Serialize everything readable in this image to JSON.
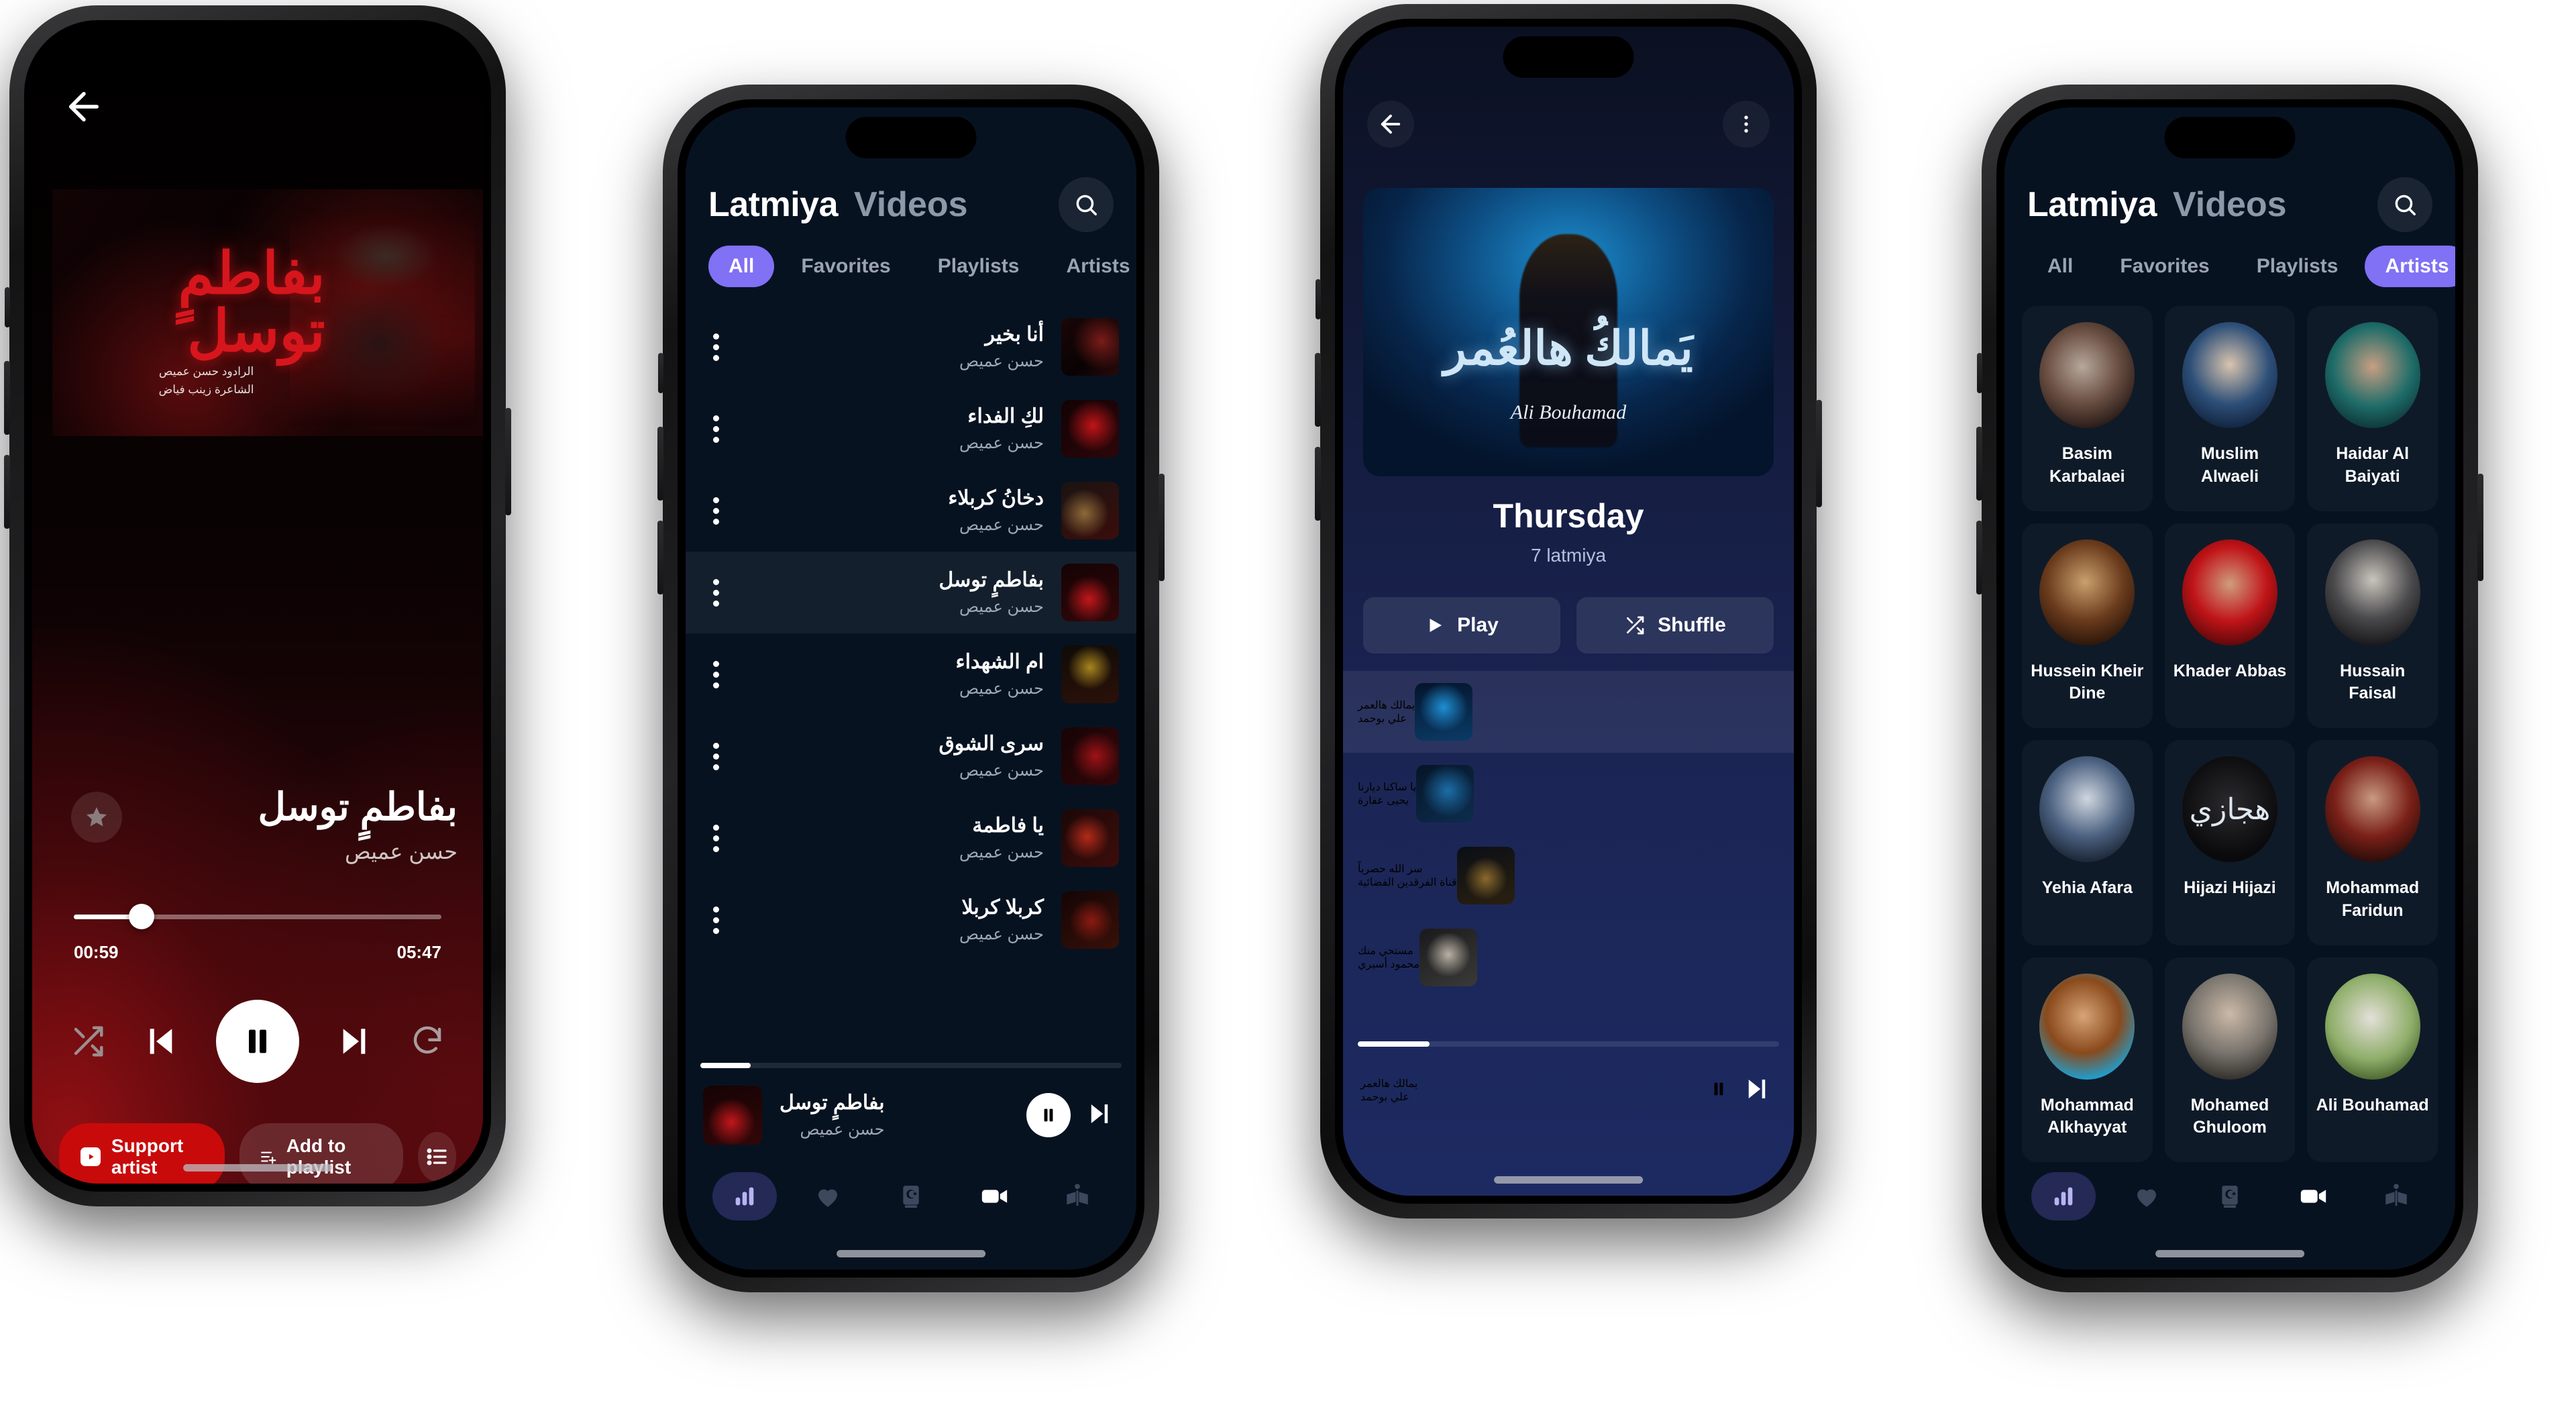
{
  "background_color": "#ffffff",
  "accent_purple": "#8071f5",
  "phone1_now_playing": {
    "back_icon": "arrow-left-icon",
    "favorite_icon": "star-icon",
    "artwork_calligraphy": "بفاطمٍ توسل",
    "artwork_credit_line1": "الرادود حسن عميص",
    "artwork_credit_line2": "الشاعرة زينب فياض",
    "track_title": "بفاطمٍ توسل",
    "track_artist": "حسن عميص",
    "time_elapsed": "00:59",
    "time_total": "05:47",
    "progress_percent": 17,
    "controls": {
      "shuffle": "shuffle-icon",
      "previous": "skip-previous-icon",
      "play_pause": "pause-icon",
      "next": "skip-next-icon",
      "repeat": "repeat-icon"
    },
    "support_button": "Support artist",
    "add_playlist_button": "Add to playlist",
    "queue_icon": "queue-list-icon"
  },
  "phone2_videos": {
    "brand": "Latmiya",
    "brand_secondary": "Videos",
    "search_icon": "search-icon",
    "tabs": [
      {
        "label": "All",
        "active": true
      },
      {
        "label": "Favorites",
        "active": false
      },
      {
        "label": "Playlists",
        "active": false
      },
      {
        "label": "Artists",
        "active": false
      }
    ],
    "rows": [
      {
        "title": "أنا بخير",
        "artist": "حسن عميص",
        "selected": false,
        "art": "tm-a"
      },
      {
        "title": "لكِ الفداء",
        "artist": "حسن عميص",
        "selected": false,
        "art": "tm-b"
      },
      {
        "title": "دخانُ كربلاء",
        "artist": "حسن عميص",
        "selected": false,
        "art": "tm-c"
      },
      {
        "title": "بفاطمٍ توسل",
        "artist": "حسن عميص",
        "selected": true,
        "art": "tm-d"
      },
      {
        "title": "ام الشهداء",
        "artist": "حسن عميص",
        "selected": false,
        "art": "tm-e"
      },
      {
        "title": "سرى الشوق",
        "artist": "حسن عميص",
        "selected": false,
        "art": "tm-f"
      },
      {
        "title": "يا فاطمة",
        "artist": "حسن عميص",
        "selected": false,
        "art": "tm-g"
      },
      {
        "title": "كربلا كربلا",
        "artist": "حسن عميص",
        "selected": false,
        "art": "tm-h"
      }
    ],
    "mini_player": {
      "title": "بفاطمٍ توسل",
      "artist": "حسن عميص",
      "play_pause_icon": "pause-icon",
      "next_icon": "skip-next-icon"
    },
    "nav": [
      {
        "name": "equalizer-icon",
        "active": true
      },
      {
        "name": "heart-icon",
        "active": false
      },
      {
        "name": "quran-book-icon",
        "active": false
      },
      {
        "name": "video-camera-icon",
        "active": true
      },
      {
        "name": "open-book-icon",
        "active": false
      }
    ]
  },
  "phone3_album": {
    "back_icon": "arrow-left-icon",
    "more_icon": "more-vertical-icon",
    "cover_calligraphy": "يَمالكُ هالعُمر",
    "cover_signature": "Ali Bouhamad",
    "album_title": "Thursday",
    "album_subtitle": "7 latmiya",
    "play_button": "Play",
    "shuffle_button": "Shuffle",
    "rows": [
      {
        "title": "يمالك هالعمر",
        "artist": "علي بوحمد",
        "selected": true,
        "art": "tm-i"
      },
      {
        "title": "يا ساكنا ديارنا",
        "artist": "يحيى عفارة",
        "selected": false,
        "art": "tm-j"
      },
      {
        "title": "سر الله حصرياً",
        "artist": "قناة الفرقدين الفضائية",
        "selected": false,
        "art": "tm-k"
      },
      {
        "title": "مستحي منك",
        "artist": "محمود أسيري",
        "selected": false,
        "art": "tm-l"
      }
    ],
    "mini_player": {
      "title": "يمالك هالعمر",
      "artist": "علي بوحمد",
      "play_pause_icon": "pause-icon",
      "next_icon": "skip-next-icon"
    }
  },
  "phone4_artists": {
    "brand": "Latmiya",
    "brand_secondary": "Videos",
    "search_icon": "search-icon",
    "tabs": [
      {
        "label": "All",
        "active": false
      },
      {
        "label": "Favorites",
        "active": false
      },
      {
        "label": "Playlists",
        "active": false
      },
      {
        "label": "Artists",
        "active": true
      }
    ],
    "artists": [
      {
        "name": "Basim Karbalaei",
        "art": "ar-1"
      },
      {
        "name": "Muslim Alwaeli",
        "art": "ar-2"
      },
      {
        "name": "Haidar Al Baiyati",
        "art": "ar-3"
      },
      {
        "name": "Hussein Kheir Dine",
        "art": "ar-4"
      },
      {
        "name": "Khader Abbas",
        "art": "ar-5"
      },
      {
        "name": "Hussain Faisal",
        "art": "ar-6"
      },
      {
        "name": "Yehia Afara",
        "art": "ar-7"
      },
      {
        "name": "Hijazi Hijazi",
        "art": "ar-8"
      },
      {
        "name": "Mohammad Faridun",
        "art": "ar-9"
      },
      {
        "name": "Mohammad Alkhayyat",
        "art": "ar-10"
      },
      {
        "name": "Mohamed Ghuloom",
        "art": "ar-11"
      },
      {
        "name": "Ali Bouhamad",
        "art": "ar-12"
      }
    ],
    "nav": [
      {
        "name": "equalizer-icon",
        "active": true
      },
      {
        "name": "heart-icon",
        "active": false
      },
      {
        "name": "quran-book-icon",
        "active": false
      },
      {
        "name": "video-camera-icon",
        "active": true
      },
      {
        "name": "open-book-icon",
        "active": false
      }
    ]
  }
}
